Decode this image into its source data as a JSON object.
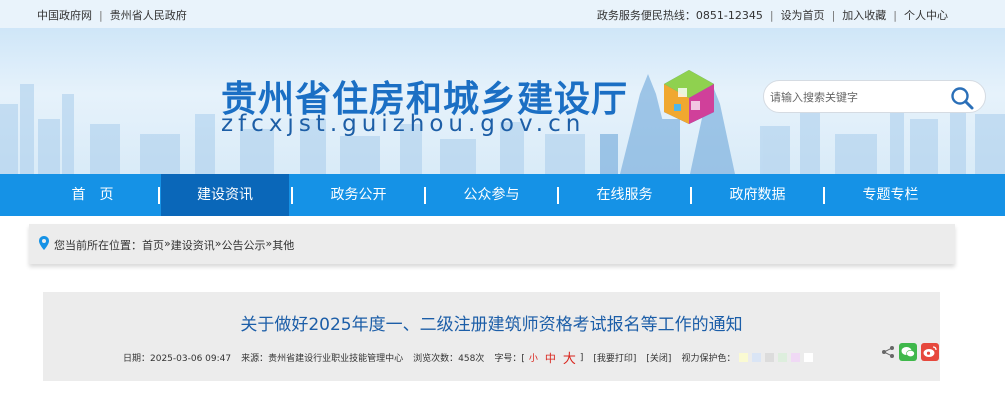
{
  "topbar": {
    "left_links": [
      "中国政府网",
      "贵州省人民政府"
    ],
    "hotline": "政务服务便民热线：0851-12345",
    "right_links": [
      "设为首页",
      "加入收藏",
      "个人中心"
    ]
  },
  "header": {
    "title_cn": "贵州省住房和城乡建设厅",
    "title_en": "zfcxjst.guizhou.gov.cn",
    "search_placeholder": "请输入搜索关键字"
  },
  "nav": {
    "items": [
      "首　页",
      "建设资讯",
      "政务公开",
      "公众参与",
      "在线服务",
      "政府数据",
      "专题专栏"
    ],
    "active_index": 1
  },
  "breadcrumb": {
    "prefix": "您当前所在位置：",
    "items": [
      "首页",
      "建设资讯",
      "公告公示",
      "其他"
    ],
    "separator": " » "
  },
  "article": {
    "title": "关于做好2025年度一、二级注册建筑师资格考试报名等工作的通知",
    "date": "日期：2025-03-06 09:47",
    "source": "来源：贵州省建设行业职业技能管理中心",
    "views": "浏览次数：458次",
    "font_size_label": "字号：[",
    "font_small": "小",
    "font_medium": "中",
    "font_large": "大",
    "font_close": "]",
    "print": "[我要打印]",
    "close": "[关闭]",
    "eye_protect": "视力保护色："
  },
  "colors": {
    "nav_bg": "#1592e6",
    "nav_active": "#0a67b9",
    "title_blue": "#1b6fc4",
    "swatches": [
      "#fafad2",
      "#dae5f5",
      "#dcdcdc",
      "#ddeedd",
      "#f0d9f5",
      "#ffffff"
    ]
  }
}
